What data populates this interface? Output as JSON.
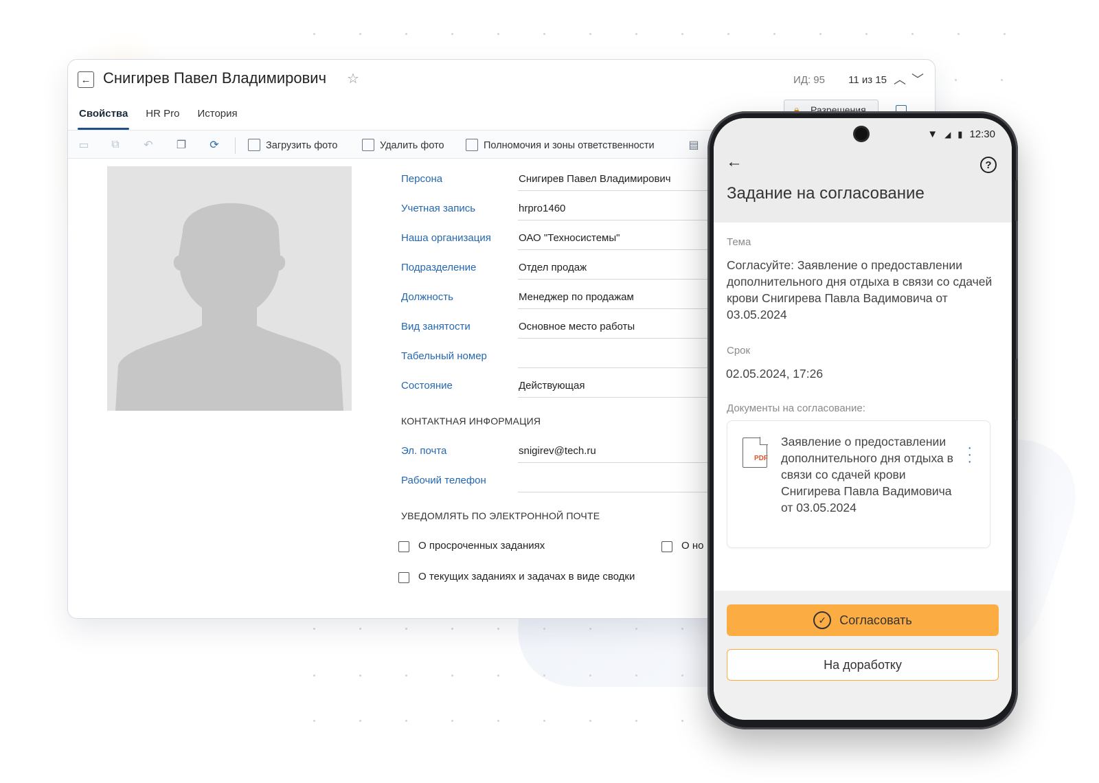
{
  "window": {
    "title": "Снигирев Павел Владимирович",
    "id_label": "ИД: 95",
    "pager": "11 из 15",
    "permissions_button": "Разрешения",
    "tabs": [
      "Свойства",
      "HR Pro",
      "История"
    ],
    "toolbar": {
      "upload_photo": "Загрузить фото",
      "delete_photo": "Удалить фото",
      "authorities": "Полномочия и зоны ответственности"
    },
    "fields": [
      {
        "label": "Персона",
        "value": "Снигирев Павел Владимирович"
      },
      {
        "label": "Учетная запись",
        "value": "hrpro1460"
      },
      {
        "label": "Наша организация",
        "value": "ОАО \"Техносистемы\""
      },
      {
        "label": "Подразделение",
        "value": "Отдел продаж"
      },
      {
        "label": "Должность",
        "value": "Менеджер по продажам"
      },
      {
        "label": "Вид занятости",
        "value": "Основное место работы"
      },
      {
        "label": "Табельный номер",
        "value": ""
      },
      {
        "label": "Состояние",
        "value": "Действующая"
      }
    ],
    "contact_section": "КОНТАКТНАЯ ИНФОРМАЦИЯ",
    "contact_fields": [
      {
        "label": "Эл. почта",
        "value": "snigirev@tech.ru"
      },
      {
        "label": "Рабочий телефон",
        "value": ""
      }
    ],
    "notify_section": "УВЕДОМЛЯТЬ ПО ЭЛЕКТРОННОЙ ПОЧТЕ",
    "checkboxes": [
      {
        "label": "О просроченных заданиях",
        "checked": false
      },
      {
        "label": "О но",
        "checked": false
      },
      {
        "label": "О текущих заданиях и задачах в виде сводки",
        "checked": false
      }
    ]
  },
  "phone": {
    "time": "12:30",
    "title": "Задание на согласование",
    "topic_label": "Тема",
    "topic_value": "Согласуйте: Заявление о предоставлении дополнительного дня отдыха в связи со сдачей крови Снигирева Павла Вадимовича от 03.05.2024",
    "deadline_label": "Срок",
    "deadline_value": "02.05.2024, 17:26",
    "docs_label": "Документы на согласование:",
    "doc_type": "PDF",
    "doc_title": "Заявление о предоставлении дополнительного дня отдыха в связи со сдачей крови Снигирева Павла Вадимовича от 03.05.2024",
    "approve_label": "Согласовать",
    "rework_label": "На доработку"
  },
  "colors": {
    "accent_orange": "#fbad44",
    "link_blue": "#2567b0",
    "tab_underline": "#1f4f86"
  }
}
